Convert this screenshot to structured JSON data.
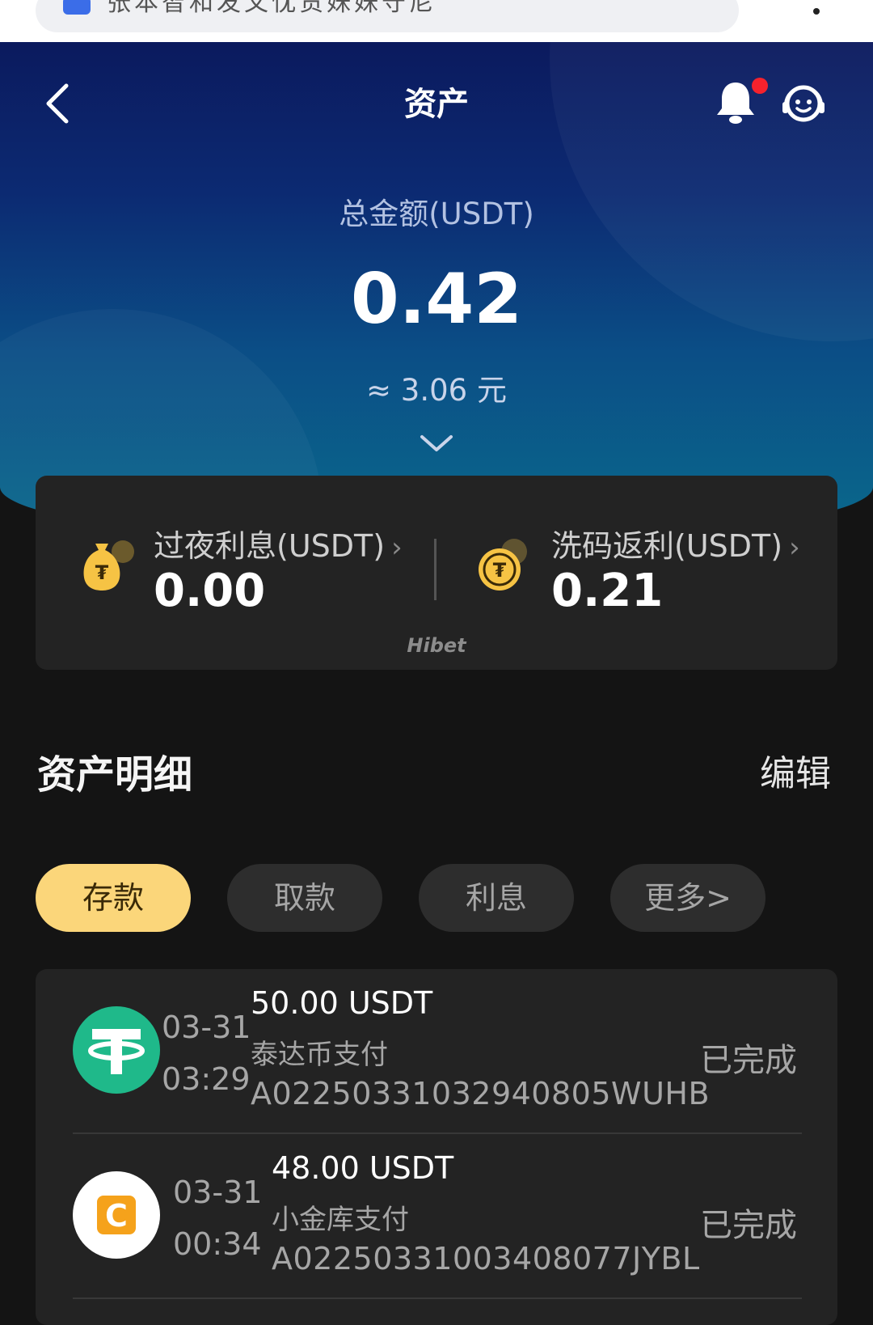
{
  "browser": {
    "url_text": "张本智和发文忱货妹妹守尼"
  },
  "header": {
    "title": "资产"
  },
  "balance": {
    "label": "总金额(USDT)",
    "value": "0.42",
    "cny": "≈ 3.06 元"
  },
  "summary": {
    "overnight": {
      "label": "过夜利息(USDT)",
      "value": "0.00"
    },
    "rebate": {
      "label": "洗码返利(USDT)",
      "value": "0.21"
    },
    "chevron": "›",
    "watermark": "Hibet"
  },
  "details": {
    "title": "资产明细",
    "edit_label": "编辑"
  },
  "tabs": [
    {
      "label": "存款",
      "active": true
    },
    {
      "label": "取款",
      "active": false
    },
    {
      "label": "利息",
      "active": false
    },
    {
      "label": "更多>",
      "active": false
    }
  ],
  "records": [
    {
      "icon": "tether-icon",
      "date": "03-31",
      "time": "03:29",
      "amount": "50.00 USDT",
      "method": "泰达币支付",
      "order_id": "A02250331032940805WUHB",
      "status": "已完成"
    },
    {
      "icon": "xiaojinku-icon",
      "date": "03-31",
      "time": "00:34",
      "amount": "48.00 USDT",
      "method": "小金库支付",
      "order_id": "A02250331003408077JYBL",
      "status": "已完成"
    }
  ],
  "colors": {
    "accent_gold": "#fbd67a",
    "tether_green": "#1fb98a",
    "xiaojinku_orange": "#f5a21b",
    "notification_red": "#f5222d"
  }
}
